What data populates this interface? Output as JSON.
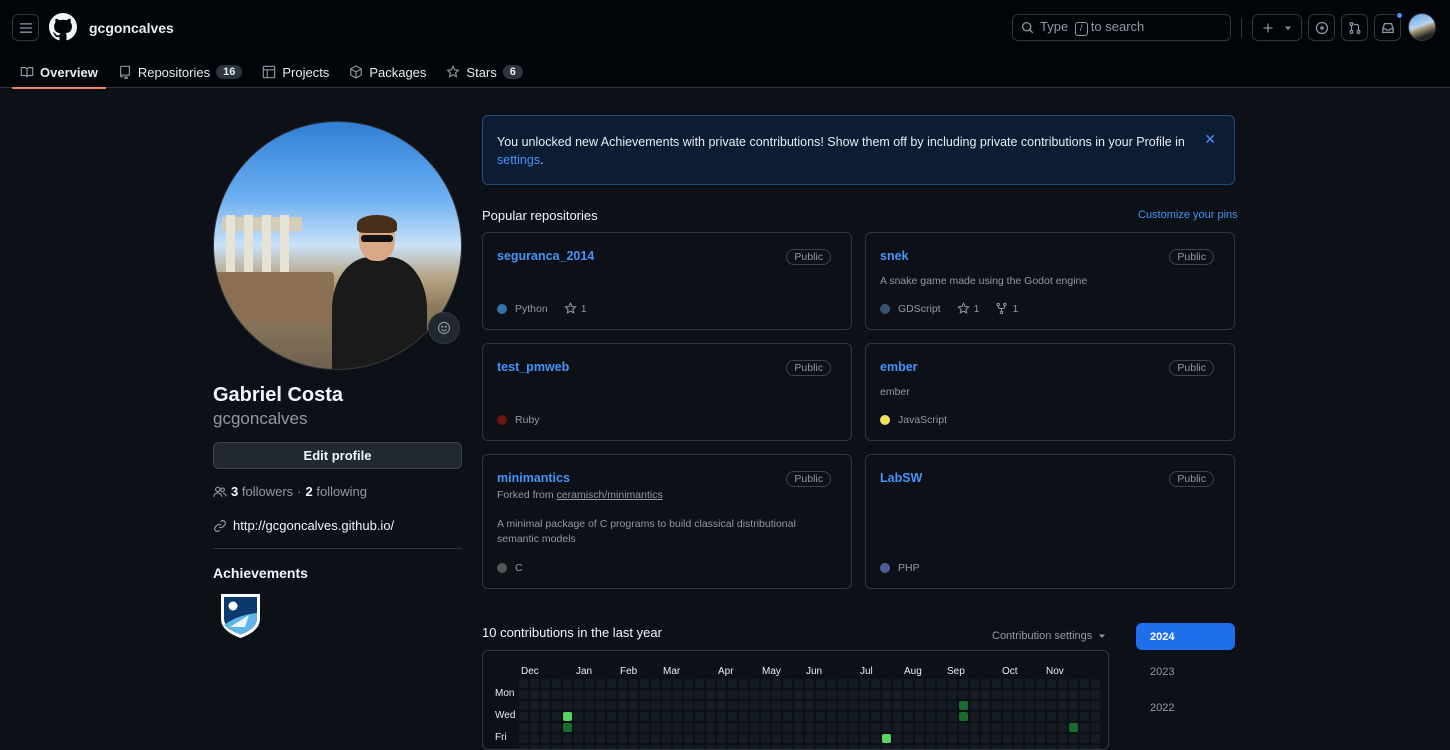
{
  "header": {
    "username": "gcgoncalves",
    "search_prefix": "Type",
    "search_key": "/",
    "search_suffix": "to search"
  },
  "tabs": [
    {
      "label": "Overview",
      "icon": "book-icon",
      "active": true
    },
    {
      "label": "Repositories",
      "icon": "repo-icon",
      "count": "16"
    },
    {
      "label": "Projects",
      "icon": "table-icon"
    },
    {
      "label": "Packages",
      "icon": "package-icon"
    },
    {
      "label": "Stars",
      "icon": "star-icon",
      "count": "6"
    }
  ],
  "profile": {
    "full_name": "Gabriel Costa",
    "login": "gcgoncalves",
    "edit_label": "Edit profile",
    "followers_count": "3",
    "followers_label": "followers",
    "separator": "·",
    "following_count": "2",
    "following_label": "following",
    "website": "http://gcgoncalves.github.io/",
    "achievements_title": "Achievements"
  },
  "banner": {
    "text": "You unlocked new Achievements with private contributions! Show them off by including private contributions in your Profile in",
    "link": "settings",
    "period": "."
  },
  "popular": {
    "title": "Popular repositories",
    "customize": "Customize your pins"
  },
  "repos": [
    {
      "name": "seguranca_2014",
      "visibility": "Public",
      "desc": "",
      "lang": "Python",
      "lang_color": "#3572A5",
      "stars": "1",
      "forks": ""
    },
    {
      "name": "snek",
      "visibility": "Public",
      "desc": "A snake game made using the Godot engine",
      "lang": "GDScript",
      "lang_color": "#355570",
      "stars": "1",
      "forks": "1"
    },
    {
      "name": "test_pmweb",
      "visibility": "Public",
      "desc": "",
      "lang": "Ruby",
      "lang_color": "#701516",
      "stars": "",
      "forks": ""
    },
    {
      "name": "ember",
      "visibility": "Public",
      "desc": "ember",
      "lang": "JavaScript",
      "lang_color": "#f1e05a",
      "stars": "",
      "forks": ""
    },
    {
      "name": "minimantics",
      "visibility": "Public",
      "fork_prefix": "Forked from",
      "fork_source": "ceramisch/minimantics",
      "desc": "A minimal package of C programs to build classical distributional semantic models",
      "lang": "C",
      "lang_color": "#555555",
      "stars": "",
      "forks": ""
    },
    {
      "name": "LabSW",
      "visibility": "Public",
      "desc": "",
      "lang": "PHP",
      "lang_color": "#4F5D95",
      "stars": "",
      "forks": ""
    }
  ],
  "contributions": {
    "title": "10 contributions in the last year",
    "settings_label": "Contribution settings",
    "months": [
      "Dec",
      "Jan",
      "Feb",
      "Mar",
      "Apr",
      "May",
      "Jun",
      "Jul",
      "Aug",
      "Sep",
      "Oct",
      "Nov"
    ],
    "days": [
      "Mon",
      "Wed",
      "Fri"
    ],
    "years": [
      "2024",
      "2023",
      "2022"
    ],
    "active_colors": {
      "light": "#196c2e",
      "strong": "#2ea043",
      "bright": "#56d364"
    }
  }
}
